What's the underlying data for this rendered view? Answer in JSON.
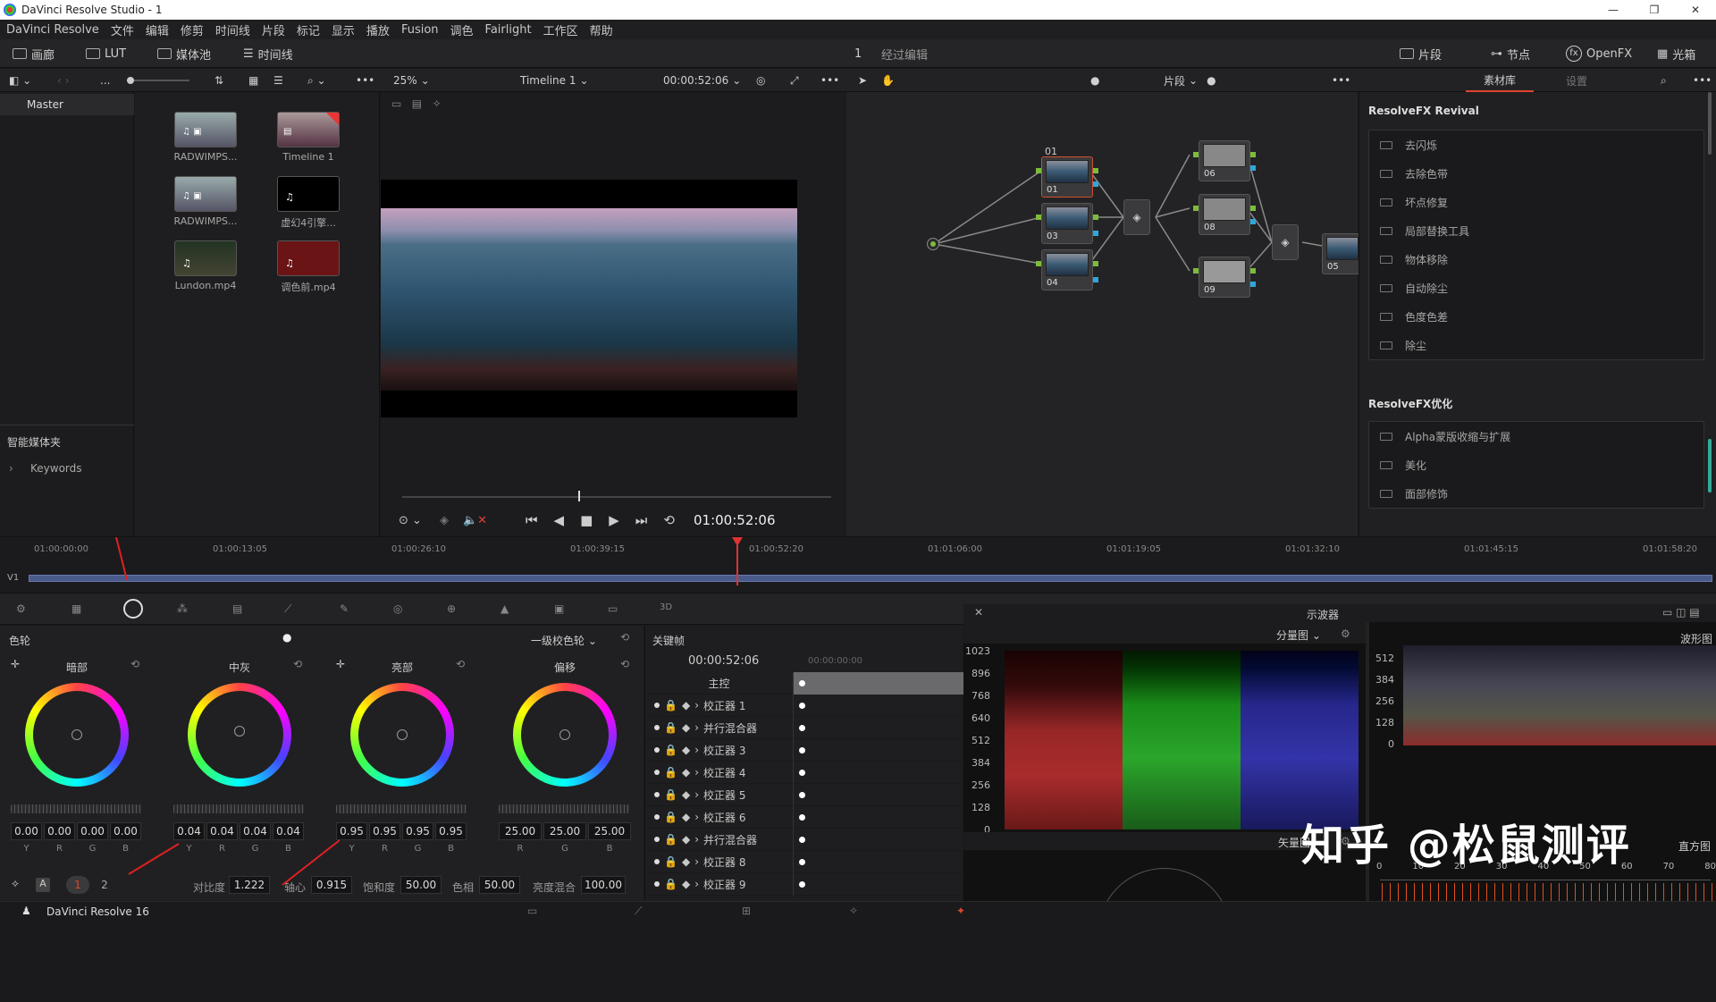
{
  "window": {
    "title": "DaVinci Resolve Studio - 1",
    "controls": [
      "—",
      "❐",
      "✕"
    ]
  },
  "menu": [
    "DaVinci Resolve",
    "文件",
    "编辑",
    "修剪",
    "时间线",
    "片段",
    "标记",
    "显示",
    "播放",
    "Fusion",
    "调色",
    "Fairlight",
    "工作区",
    "帮助"
  ],
  "toolbar": {
    "gallery": "画廊",
    "lut": "LUT",
    "media_pool": "媒体池",
    "timeline": "时间线",
    "page_number": "1",
    "page_label": "经过编辑",
    "clips": "片段",
    "nodes": "节点",
    "openfx": "OpenFX",
    "lightbox": "光箱"
  },
  "subbar": {
    "zoom": "25%",
    "timeline_name": "Timeline 1",
    "timecode": "00:00:52:06",
    "clip_mode": "片段",
    "tab_library": "素材库",
    "tab_settings": "设置",
    "ellipsis": "..."
  },
  "left_panel": {
    "master": "Master",
    "smart_bins": "智能媒体夹",
    "keywords": "Keywords"
  },
  "media": [
    {
      "name": "RADWIMPS...",
      "kind": "audio-video"
    },
    {
      "name": "Timeline 1",
      "kind": "timeline"
    },
    {
      "name": "RADWIMPS...",
      "kind": "audio-video"
    },
    {
      "name": "虚幻4引擎...",
      "kind": "audio"
    },
    {
      "name": "Lundon.mp4",
      "kind": "video"
    },
    {
      "name": "调色前.mp4",
      "kind": "video-red"
    }
  ],
  "viewer": {
    "timecode": "01:00:52:06"
  },
  "nodes": {
    "group_label": "01",
    "items": [
      "01",
      "03",
      "04",
      "06",
      "08",
      "09",
      "05"
    ]
  },
  "fx": {
    "group1_title": "ResolveFX Revival",
    "group1": [
      "去闪烁",
      "去除色带",
      "坏点修复",
      "局部替换工具",
      "物体移除",
      "自动除尘",
      "色度色差",
      "除尘"
    ],
    "group2_title": "ResolveFX优化",
    "group2": [
      "Alpha蒙版收缩与扩展",
      "美化",
      "面部修饰"
    ]
  },
  "timeline": {
    "track": "V1",
    "ticks": [
      "01:00:00:00",
      "01:00:13:05",
      "01:00:26:10",
      "01:00:39:15",
      "01:00:52:20",
      "01:01:06:00",
      "01:01:19:05",
      "01:01:32:10",
      "01:01:45:15",
      "01:01:58:20"
    ]
  },
  "wheels": {
    "title": "色轮",
    "mode": "一级校色轮",
    "items": [
      {
        "name": "暗部",
        "values": [
          "0.00",
          "0.00",
          "0.00",
          "0.00"
        ],
        "labels": [
          "Y",
          "R",
          "G",
          "B"
        ]
      },
      {
        "name": "中灰",
        "values": [
          "0.04",
          "0.04",
          "0.04",
          "0.04"
        ],
        "labels": [
          "Y",
          "R",
          "G",
          "B"
        ]
      },
      {
        "name": "亮部",
        "values": [
          "0.95",
          "0.95",
          "0.95",
          "0.95"
        ],
        "labels": [
          "Y",
          "R",
          "G",
          "B"
        ]
      },
      {
        "name": "偏移",
        "values": [
          "25.00",
          "25.00",
          "25.00"
        ],
        "labels": [
          "R",
          "G",
          "B"
        ]
      }
    ],
    "pages": [
      "1",
      "2"
    ],
    "contrast_label": "对比度",
    "contrast": "1.222",
    "pivot_label": "轴心",
    "pivot": "0.915",
    "saturation_label": "饱和度",
    "saturation": "50.00",
    "hue_label": "色相",
    "hue": "50.00",
    "lummix_label": "亮度混合",
    "lummix": "100.00"
  },
  "keyframes": {
    "title": "关键帧",
    "timecode": "00:00:52:06",
    "track_tc": "00:00:00:00",
    "master": "主控",
    "rows": [
      "校正器 1",
      "并行混合器",
      "校正器 3",
      "校正器 4",
      "校正器 5",
      "校正器 6",
      "并行混合器",
      "校正器 8",
      "校正器 9"
    ]
  },
  "scopes": {
    "title": "示波器",
    "mode": "分量图",
    "wave_label": "波形图",
    "vector_label": "矢量图",
    "histo_label": "直方图",
    "scale": [
      "1023",
      "896",
      "768",
      "640",
      "512",
      "384",
      "256",
      "128",
      "0"
    ],
    "scale2": [
      "512",
      "384",
      "256",
      "128",
      "0"
    ],
    "histo_ticks": [
      "0",
      "10",
      "20",
      "30",
      "40",
      "50",
      "60",
      "70",
      "80"
    ]
  },
  "watermark": "知乎 @松鼠测评",
  "status": {
    "app": "DaVinci Resolve 16"
  }
}
